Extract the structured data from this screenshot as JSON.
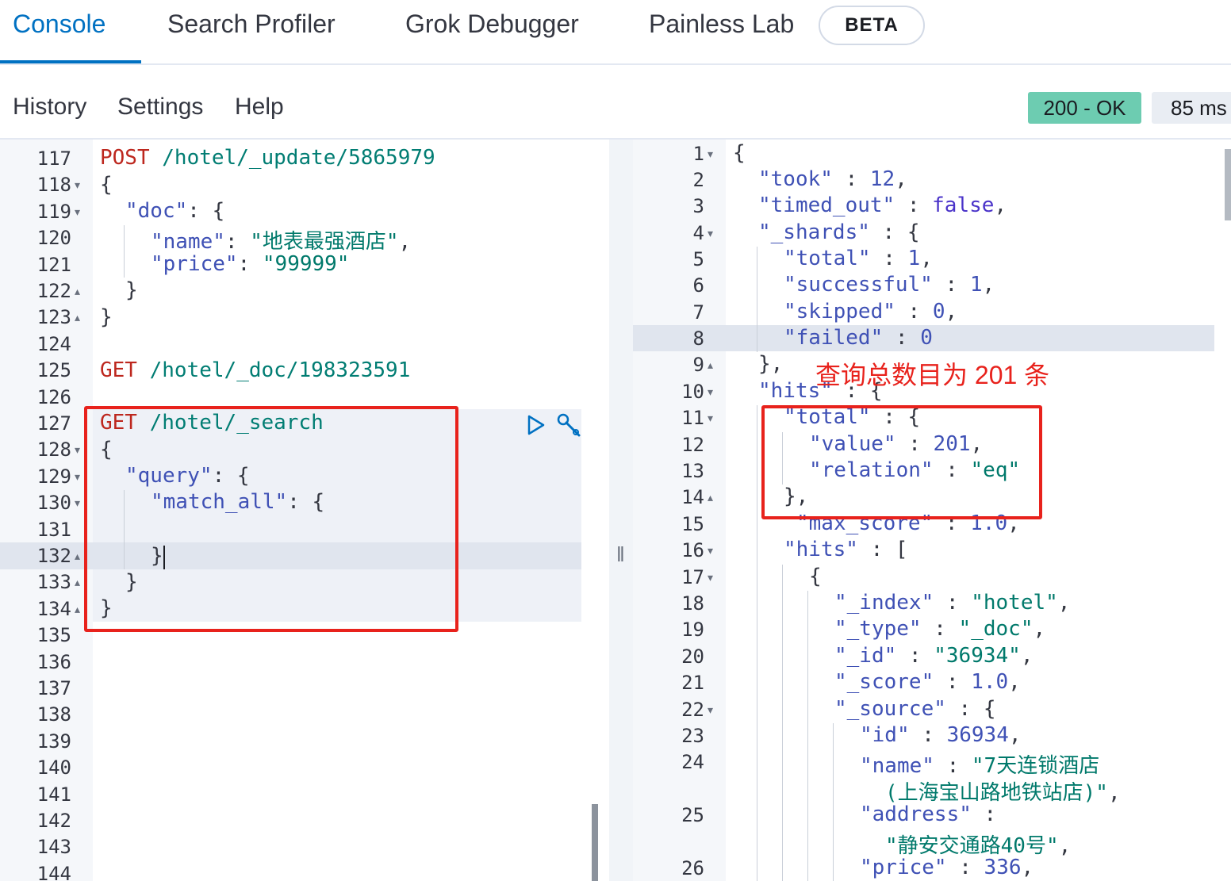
{
  "tabs": [
    {
      "label": "Console",
      "active": true
    },
    {
      "label": "Search Profiler"
    },
    {
      "label": "Grok Debugger"
    },
    {
      "label": "Painless Lab"
    }
  ],
  "beta_badge": "BETA",
  "subnav": {
    "history": "History",
    "settings": "Settings",
    "help": "Help"
  },
  "status": {
    "code": "200 - OK",
    "time": "85 ms",
    "color": "#6dccb1"
  },
  "request_editor": {
    "line_numbers": [
      "117",
      "118",
      "119",
      "120",
      "121",
      "122",
      "123",
      "124",
      "125",
      "126",
      "127",
      "128",
      "129",
      "130",
      "131",
      "132",
      "133",
      "134",
      "135",
      "136",
      "137",
      "138",
      "139",
      "140",
      "141",
      "142",
      "143",
      "144"
    ],
    "lines": {
      "l117_method": "POST",
      "l117_url": " /hotel/_update/5865979",
      "l118": "{",
      "l119_key": "\"doc\"",
      "l119_rest": ": {",
      "l120_key": "\"name\"",
      "l120_sep": ": ",
      "l120_val": "\"地表最强酒店\"",
      "l120_end": ",",
      "l121_key": "\"price\"",
      "l121_sep": ": ",
      "l121_val": "\"99999\"",
      "l122": "}",
      "l123": "}",
      "l125_method": "GET",
      "l125_url": " /hotel/_doc/198323591",
      "l127_method": "GET",
      "l127_url": " /hotel/_search",
      "l128": "{",
      "l129_key": "\"query\"",
      "l129_rest": ": {",
      "l130_key": "\"match_all\"",
      "l130_rest": ": {",
      "l132": "}",
      "l133": "}",
      "l134": "}"
    }
  },
  "response_editor": {
    "line_numbers": [
      "1",
      "2",
      "3",
      "4",
      "5",
      "6",
      "7",
      "8",
      "9",
      "10",
      "11",
      "12",
      "13",
      "14",
      "15",
      "16",
      "17",
      "18",
      "19",
      "20",
      "21",
      "22",
      "23",
      "24",
      "25",
      "26"
    ],
    "lines": {
      "r1": "{",
      "r2_key": "\"took\"",
      "r2_sep": " : ",
      "r2_val": "12",
      "r2_end": ",",
      "r3_key": "\"timed_out\"",
      "r3_sep": " : ",
      "r3_val": "false",
      "r3_end": ",",
      "r4_key": "\"_shards\"",
      "r4_rest": " : {",
      "r5_key": "\"total\"",
      "r5_sep": " : ",
      "r5_val": "1",
      "r5_end": ",",
      "r6_key": "\"successful\"",
      "r6_sep": " : ",
      "r6_val": "1",
      "r6_end": ",",
      "r7_key": "\"skipped\"",
      "r7_sep": " : ",
      "r7_val": "0",
      "r7_end": ",",
      "r8_key": "\"failed\"",
      "r8_sep": " : ",
      "r8_val": "0",
      "r9": "},",
      "r10_key": "\"hits\"",
      "r10_rest": " : {",
      "r11_key": "\"total\"",
      "r11_rest": " : {",
      "r12_key": "\"value\"",
      "r12_sep": " : ",
      "r12_val": "201",
      "r12_end": ",",
      "r13_key": "\"relation\"",
      "r13_sep": " : ",
      "r13_val": "\"eq\"",
      "r14": "},",
      "r15_key": "\"max_score\"",
      "r15_sep": " : ",
      "r15_val": "1.0",
      "r15_end": ",",
      "r16_key": "\"hits\"",
      "r16_rest": " : [",
      "r17": "{",
      "r18_key": "\"_index\"",
      "r18_sep": " : ",
      "r18_val": "\"hotel\"",
      "r18_end": ",",
      "r19_key": "\"_type\"",
      "r19_sep": " : ",
      "r19_val": "\"_doc\"",
      "r19_end": ",",
      "r20_key": "\"_id\"",
      "r20_sep": " : ",
      "r20_val": "\"36934\"",
      "r20_end": ",",
      "r21_key": "\"_score\"",
      "r21_sep": " : ",
      "r21_val": "1.0",
      "r21_end": ",",
      "r22_key": "\"_source\"",
      "r22_rest": " : {",
      "r23_key": "\"id\"",
      "r23_sep": " : ",
      "r23_val": "36934",
      "r23_end": ",",
      "r24_key": "\"name\"",
      "r24_sep": " : ",
      "r24_val": "\"7天连锁酒店",
      "r24b_val": "(上海宝山路地铁站店)\"",
      "r24b_end": ",",
      "r25_key": "\"address\"",
      "r25_sep": " :",
      "r25_val": "\"静安交通路40号\"",
      "r25_end": ",",
      "r26_key": "\"price\"",
      "r26_sep": " : ",
      "r26_val": "336",
      "r26_end": ","
    }
  },
  "annotation": "查询总数目为 201 条",
  "icons": [
    "play-icon",
    "wrench-icon",
    "fold-arrow-icon"
  ]
}
